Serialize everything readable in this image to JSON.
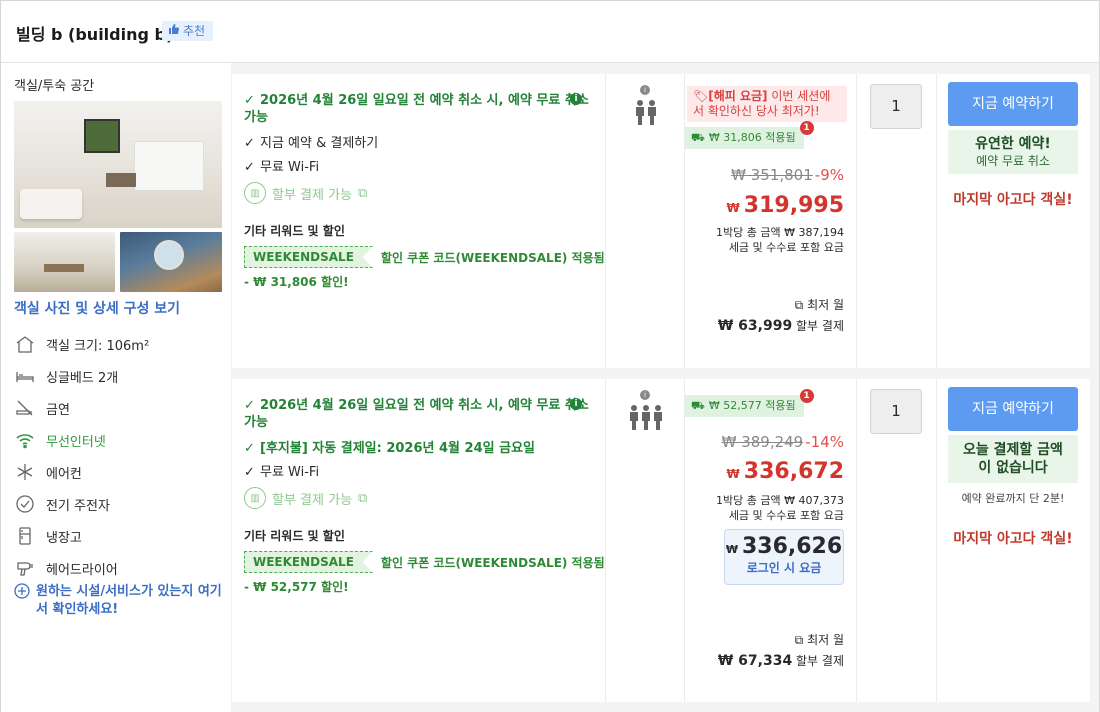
{
  "header": {
    "title": "빌딩 b (building b)",
    "badge": "추천"
  },
  "left": {
    "room_label": "객실/투숙 공간",
    "view_link": "객실 사진 및 상세 구성 보기",
    "amenities": [
      {
        "icon": "house-icon",
        "label": "객실 크기: 106m²"
      },
      {
        "icon": "bed-icon",
        "label": "싱글베드 2개"
      },
      {
        "icon": "no-smoking-icon",
        "label": "금연"
      },
      {
        "icon": "wifi-icon",
        "label": "무선인터넷"
      },
      {
        "icon": "snowflake-icon",
        "label": "에어컨"
      },
      {
        "icon": "kettle-icon",
        "label": "전기 주전자"
      },
      {
        "icon": "fridge-icon",
        "label": "냉장고"
      },
      {
        "icon": "hairdryer-icon",
        "label": "헤어드라이어"
      }
    ],
    "more_link": "원하는 시설/서비스가 있는지 여기서 확인하세요!"
  },
  "rows": [
    {
      "cancel": "2026년 4월 26일 일요일 전 예약 취소 시, 예약 무료 취소 가능",
      "benefit2": "지금 예약 & 결제하기",
      "benefit3": "무료 Wi-Fi",
      "installment": "할부 결제 가능",
      "others_title": "기타 리워드 및 할인",
      "coupon_tag": "WEEKENDSALE",
      "coupon_desc": "할인 쿠폰 코드(WEEKENDSALE) 적용됨",
      "discount": "- ₩ 31,806 할인!",
      "happy_label": "[해피 요금]",
      "happy_text": " 이번 세션에서 확인하신 당사 최저가!",
      "applied": "₩ 31,806 적용됨",
      "applied_count": "1",
      "original": "₩ 351,801",
      "percent": "-9%",
      "currency": "₩",
      "final": "319,995",
      "per_night": "1박당 총 금액 ₩ 387,194",
      "tax_note": "세금 및 수수료 포함 요금",
      "monthly_label": "최저 월",
      "monthly_amount": "₩ 63,999",
      "monthly_suffix": " 할부 결제",
      "qty": "1",
      "book": "지금 예약하기",
      "flex_title": "유연한 예약!",
      "flex_sub": "예약 무료 취소",
      "last": "마지막 아고다 객실!"
    },
    {
      "cancel": "2026년 4월 26일 일요일 전 예약 취소 시, 예약 무료 취소 가능",
      "benefit2": "[후지불] 자동 결제일: 2026년 4월 24일 금요일",
      "benefit3": "무료 Wi-Fi",
      "installment": "할부 결제 가능",
      "others_title": "기타 리워드 및 할인",
      "coupon_tag": "WEEKENDSALE",
      "coupon_desc": "할인 쿠폰 코드(WEEKENDSALE) 적용됨",
      "discount": "- ₩ 52,577 할인!",
      "applied": "₩ 52,577 적용됨",
      "applied_count": "1",
      "original": "₩ 389,249",
      "percent": "-14%",
      "currency": "₩",
      "final": "336,672",
      "per_night": "1박당 총 금액 ₩ 407,373",
      "tax_note": "세금 및 수수료 포함 요금",
      "login_price": "336,626",
      "login_label": "로그인 시 요금",
      "monthly_label": "최저 월",
      "monthly_amount": "₩ 67,334",
      "monthly_suffix": " 할부 결제",
      "qty": "1",
      "book": "지금 예약하기",
      "flex_title": "오늘 결제할 금액이 없습니다",
      "note": "예약 완료까지 단 2분!",
      "last": "마지막 아고다 객실!"
    }
  ]
}
